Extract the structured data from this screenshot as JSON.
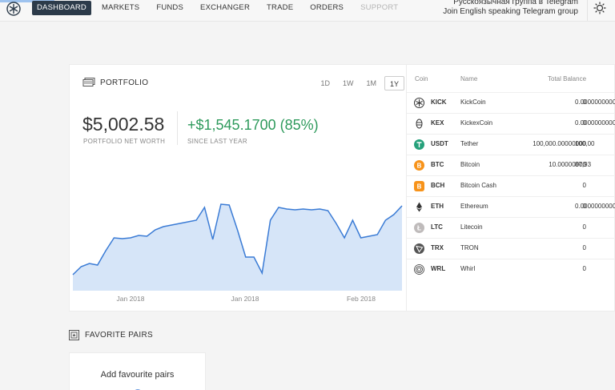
{
  "nav": {
    "items": [
      {
        "label": "DASHBOARD",
        "active": true
      },
      {
        "label": "MARKETS"
      },
      {
        "label": "FUNDS"
      },
      {
        "label": "EXCHANGER"
      },
      {
        "label": "TRADE"
      },
      {
        "label": "ORDERS"
      },
      {
        "label": "SUPPORT",
        "disabled": true
      }
    ],
    "telegram_ru": "Русскоязычная группа в Telegram",
    "telegram_en": "Join English speaking Telegram group"
  },
  "portfolio": {
    "title": "PORTFOLIO",
    "ranges": [
      "1D",
      "1W",
      "1M",
      "1Y"
    ],
    "active_range": "1Y",
    "net_worth": "$5,002.58",
    "net_worth_label": "PORTFOLIO NET WORTH",
    "change": "+$1,545.1700 (85%)",
    "change_label": "SINCE LAST YEAR"
  },
  "chart_data": {
    "type": "area",
    "x_tick_labels": [
      "Jan 2018",
      "Jan 2018",
      "Feb 2018"
    ],
    "values": [
      20,
      30,
      34,
      32,
      50,
      66,
      65,
      66,
      69,
      68,
      76,
      80,
      82,
      84,
      86,
      88,
      104,
      64,
      108,
      107,
      76,
      42,
      42,
      22,
      88,
      104,
      102,
      101,
      102,
      101,
      102,
      100,
      84,
      66,
      88,
      66,
      68,
      70,
      88,
      95,
      106
    ],
    "grid": false,
    "color": "#3a7bd5",
    "fill": "#d6e5f8"
  },
  "coins": {
    "headers": {
      "coin": "Coin",
      "name": "Name",
      "total": "Total Balance"
    },
    "rows": [
      {
        "symbol": "KICK",
        "name": "KickCoin",
        "total": "0",
        "extra": "0.0000000000",
        "icon": "kickcoin-icon",
        "color": "#333333"
      },
      {
        "symbol": "KEX",
        "name": "KickexCoin",
        "total": "0",
        "extra": "0.0000000000",
        "icon": "kickex-icon",
        "color": "#333333"
      },
      {
        "symbol": "USDT",
        "name": "Tether",
        "total": "100,000.00000000",
        "extra": "100,00",
        "icon": "tether-icon",
        "color": "#26a17b"
      },
      {
        "symbol": "BTC",
        "name": "Bitcoin",
        "total": "10.00000000",
        "extra": "87,93",
        "icon": "bitcoin-icon",
        "color": "#f7931a"
      },
      {
        "symbol": "BCH",
        "name": "Bitcoin Cash",
        "total": "0",
        "extra": "",
        "icon": "bitcoin-cash-icon",
        "color": "#f7931a"
      },
      {
        "symbol": "ETH",
        "name": "Ethereum",
        "total": "0",
        "extra": "0.0000000000",
        "icon": "ethereum-icon",
        "color": "#333333"
      },
      {
        "symbol": "LTC",
        "name": "Litecoin",
        "total": "0",
        "extra": "",
        "icon": "litecoin-icon",
        "color": "#bfbbbb"
      },
      {
        "symbol": "TRX",
        "name": "TRON",
        "total": "0",
        "extra": "",
        "icon": "tron-icon",
        "color": "#555555"
      },
      {
        "symbol": "WRL",
        "name": "Whirl",
        "total": "0",
        "extra": "",
        "icon": "whirl-icon",
        "color": "#333333"
      }
    ]
  },
  "favorites": {
    "title": "FAVORITE PAIRS",
    "empty_text": "Add favourite pairs"
  }
}
